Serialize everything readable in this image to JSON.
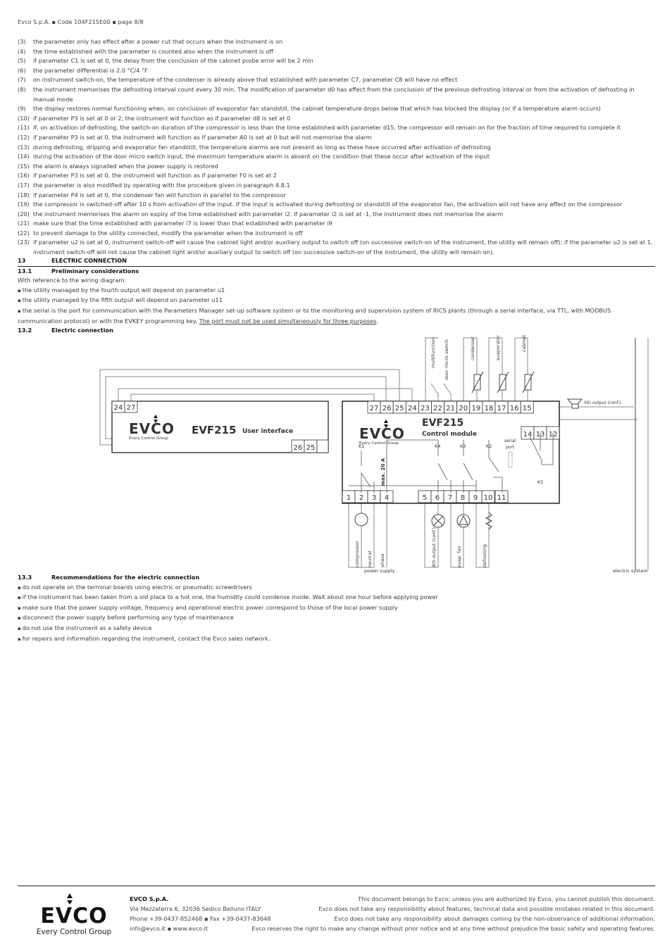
{
  "header": "Evco S.p.A. ▪ Code 104F215E00 ▪ page 8/8",
  "notes": [
    {
      "n": "(3)",
      "t": "the parameter only has effect after a power cut that occurs when the instrument is on"
    },
    {
      "n": "(4)",
      "t": "the time established with the parameter is counted also when the instrument is off"
    },
    {
      "n": "(5)",
      "t": "if parameter C1 is set at 0, the delay from the conclusion of the cabinet probe error will be 2 min"
    },
    {
      "n": "(6)",
      "t": "the parameter differential is 2.0 °C/4 °F"
    },
    {
      "n": "(7)",
      "t": "on instrument switch-on, the temperature of the condenser is already above that established with parameter C7, parameter C8 will have no effect"
    },
    {
      "n": "(8)",
      "t": "the instrument memorises the defrosting interval count every 30 min. The modification of parameter d0 has effect from the conclusion of the previous defrosting interval or from the activation of defrosting in manual mode"
    },
    {
      "n": "(9)",
      "t": "the display restores normal functioning when, on conclusion of evaporator fan standstill, the cabinet temperature drops below that which has blocked the display (or if a temperature alarm occurs)"
    },
    {
      "n": "(10)",
      "t": "if parameter P3 is set at 0 or 2, the instrument will function as if parameter d8 is set at 0"
    },
    {
      "n": "(11)",
      "t": "if, on activation of defrosting, the switch-on duration of the compressor is less than the time established with parameter d15, the compressor will remain on for the fraction of time required to complete it"
    },
    {
      "n": "(12)",
      "t": "if parameter P3 is set at 0, the instrument will function as if parameter A0 is set at 0 but will not memorise the alarm"
    },
    {
      "n": "(13)",
      "t": "during defrosting, dripping and evaporator fan standstill, the temperature alarms are not present as long as these have occurred after activation of defrosting"
    },
    {
      "n": "(14)",
      "t": "during the activation of the door micro switch input, the maximum temperature alarm is absent on the condition that these occur after activation of the input"
    },
    {
      "n": "(15)",
      "t": "the alarm is always signalled when the power supply is restored"
    },
    {
      "n": "(16)",
      "t": "if parameter P3 is set at 0, the instrument will function as if parameter F0 is set at 2"
    },
    {
      "n": "(17)",
      "t": "the parameter is also modified by operating with the procedure given in paragraph 4.8.1"
    },
    {
      "n": "(18)",
      "t": "if parameter P4 is set at 0, the condenser fan will function in parallel to the compressor"
    },
    {
      "n": "(19)",
      "t": "the compressor is switched-off after 10 s from activation of the input. If the input is activated during defrosting or standstill of the evaporator fan, the activation will not have any effect on the compressor"
    },
    {
      "n": "(20)",
      "t": "the instrument memorises the alarm on expiry of the time established with parameter i2. If parameter i2 is set at -1, the instrument does not memorise the alarm"
    },
    {
      "n": "(21)",
      "t": "make sure that the time established with parameter i7 is lower than that established with parameter i9"
    },
    {
      "n": "(22)",
      "t": "to prevent damage to the utility connected, modify the parameter when the instrument is off"
    },
    {
      "n": "(23)",
      "t": "if parameter u2 is set at 0, instrument switch-off will cause the cabinet light and/or auxiliary output to switch off (on successive switch-on of the instrument, the utility will remain off); if the parameter u2 is set at 1, instrument switch-off will not cause the cabinet light and/or auxiliary output to switch off (on successive switch-on of the instrument, the utility will remain on)."
    }
  ],
  "s13": {
    "num": "13",
    "title": "ELECTRIC CONNECTION"
  },
  "s131": {
    "num": "13.1",
    "title": "Preliminary  considerations",
    "intro": "With reference to the wiring diagram:",
    "bullets": [
      "the utility managed by the fourth output will depend on parameter u1",
      "the utility managed by the fifth output will depend on parameter u11"
    ],
    "serial_text": "the serial is the port for communication with the Parameters Manager set-up software system or to the monitoring and supervision system of RICS plants (through a serial interface, via TTL, with MODBUS communication protocol) or with the EVKEY programming key. ",
    "serial_underlined": "The port must not be used simultaneously for three purposes",
    "serial_end": "."
  },
  "s132": {
    "num": "13.2",
    "title": "Electric  connection"
  },
  "diagram": {
    "ui": {
      "model": "EVF215",
      "label": "User interface",
      "terminals_top": [
        "24",
        "27"
      ],
      "terminals_bottom": [
        "26",
        "25"
      ]
    },
    "cm": {
      "model": "EVF215",
      "label": "Control module",
      "terminals_top": [
        "27",
        "26",
        "25",
        "24",
        "23",
        "22",
        "21",
        "20",
        "19",
        "18",
        "17",
        "16",
        "15"
      ],
      "terminals_right": [
        "14",
        "13",
        "12"
      ],
      "terminals_bottom": [
        "1",
        "2",
        "3",
        "4",
        "5",
        "6",
        "7",
        "8",
        "9",
        "10",
        "11"
      ],
      "relays": [
        "K1",
        "K4",
        "K3",
        "K2",
        "K5"
      ],
      "serial_port": [
        "serial",
        "port"
      ],
      "max_current": "max. 20 A"
    },
    "logo_text": "EVCO",
    "logo_tagline": "Every  Control  Group",
    "inputs": [
      "multifunction",
      "door micro switch",
      "condenser",
      "evaporator",
      "cabinet"
    ],
    "outputs": [
      "compressor",
      "neutral",
      "phase",
      "4th output (conf.)",
      "evap. fan",
      "defrosting"
    ],
    "power_supply": "power supply",
    "fifth_output": "5th output (conf.)",
    "electric_system": "electric system"
  },
  "s133": {
    "num": "13.3",
    "title": "Recommendations for the electric connection",
    "bullets": [
      "do not operate on the terminal boards using electric or pneumatic screwdrivers",
      "if the instrument has been taken from a old place to a hot one, the humidity could condense inside. Wait about one hour before applying power",
      "make sure that the power supply voltage, frequency and operational electric power correspond to those of the local power supply",
      "disconnect the power supply before performing any type of maintenance",
      "do not use the instrument as a safety device",
      "for repairs and information regarding the instrument, contact the Evco sales network."
    ]
  },
  "footer": {
    "logo_text": "EVCO",
    "logo_tagline": "Every  Control  Group",
    "company": "EVCO S.p.A.",
    "address": "Via Mezzaterra 6,  32036 Sedico Belluno ITALY",
    "phone": "Phone +39-0437-852468 ▪ Fax +39-0437-83648",
    "web": "info@evco.it ▪ www.evco.it",
    "disclaimers": [
      "This document belongs to Evco; unless you are authorized by Evco, you cannot publish this document.",
      "Evco does not take any responsibility about features, technical data and possible mistakes related in this document.",
      "Evco does not take any responsibility about damages coming by the non-observance of additional information.",
      "Evco reserves the right to make any change without prior notice and at any time without prejudice the basic safety and operating features."
    ]
  }
}
